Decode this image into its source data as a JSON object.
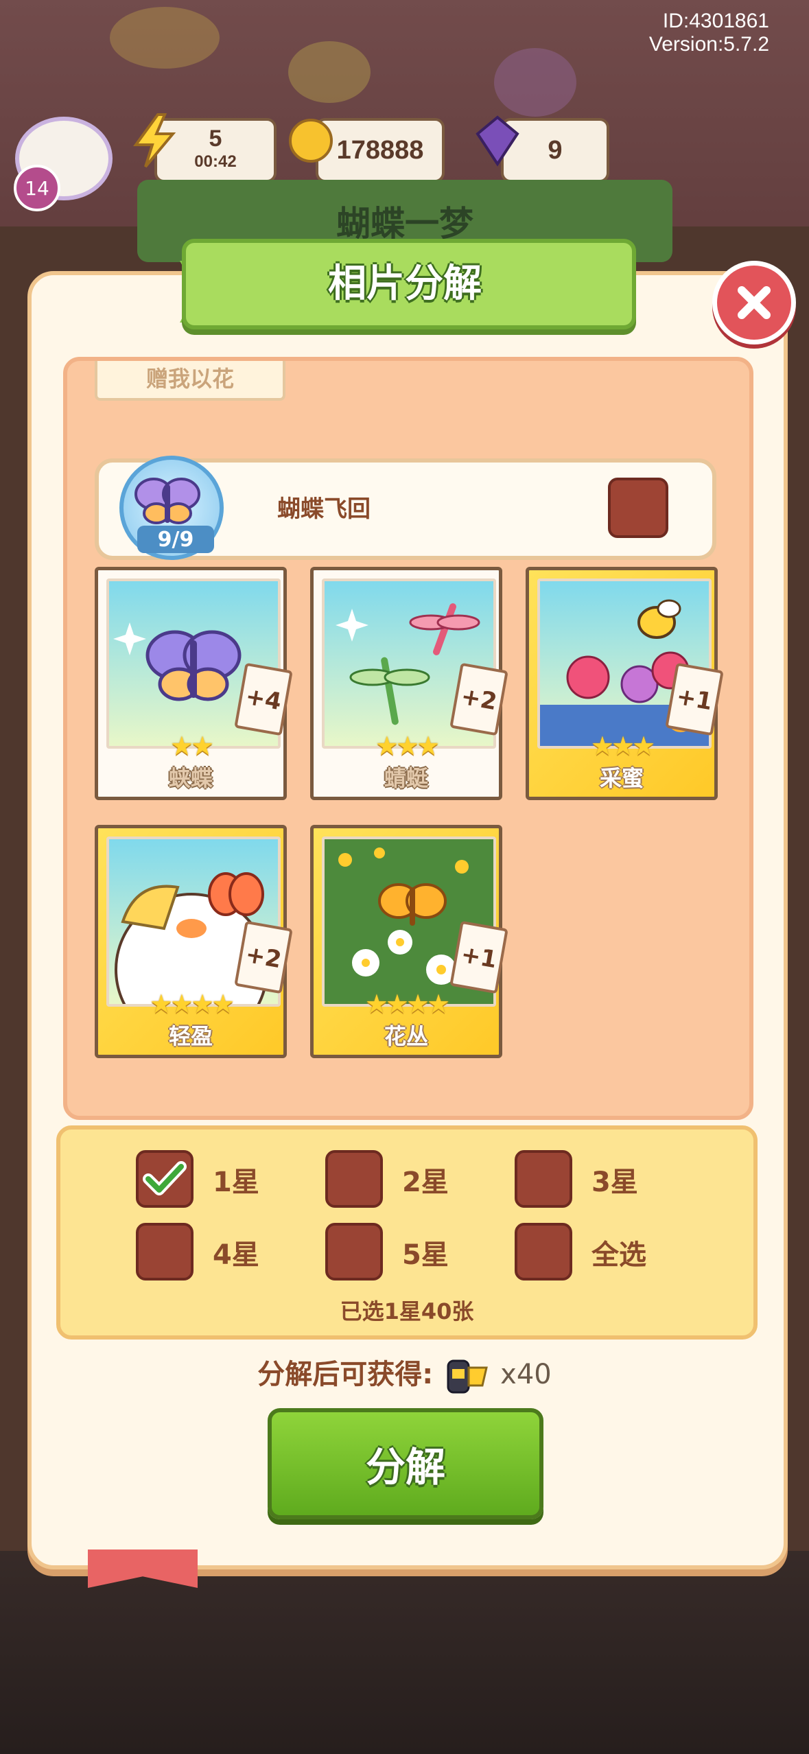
{
  "header": {
    "id_label": "ID:4301861",
    "version_label": "Version:5.7.2"
  },
  "hud": {
    "level": "14",
    "energy": "5",
    "energy_timer": "00:42",
    "coins": "178888",
    "gems": "9"
  },
  "background_banner": "蝴蝶一梦",
  "dialog": {
    "title": "相片分解",
    "previous_set_name": "赠我以花",
    "set": {
      "name": "蝴蝶飞回",
      "progress": "9/9"
    },
    "cards": [
      {
        "name": "蛱蝶",
        "stars": "★★",
        "plus": "+4",
        "frame": "silver"
      },
      {
        "name": "蜻蜓",
        "stars": "★★★",
        "plus": "+2",
        "frame": "silver"
      },
      {
        "name": "采蜜",
        "stars": "★★★",
        "plus": "+1",
        "frame": "gold"
      },
      {
        "name": "轻盈",
        "stars": "★★★★",
        "plus": "+2",
        "frame": "gold"
      },
      {
        "name": "花丛",
        "stars": "★★★★",
        "plus": "+1",
        "frame": "gold"
      }
    ],
    "filters": [
      {
        "label": "1星",
        "checked": true
      },
      {
        "label": "2星",
        "checked": false
      },
      {
        "label": "3星",
        "checked": false
      },
      {
        "label": "4星",
        "checked": false
      },
      {
        "label": "5星",
        "checked": false
      },
      {
        "label": "全选",
        "checked": false
      }
    ],
    "selected_summary": "已选1星40张",
    "reward_label": "分解后可获得:",
    "reward_qty": "x40",
    "decompose_button": "分解"
  },
  "colors": {
    "accent_green": "#6fa934",
    "panel_bg": "#fff7e8",
    "close_red": "#e2545a"
  }
}
